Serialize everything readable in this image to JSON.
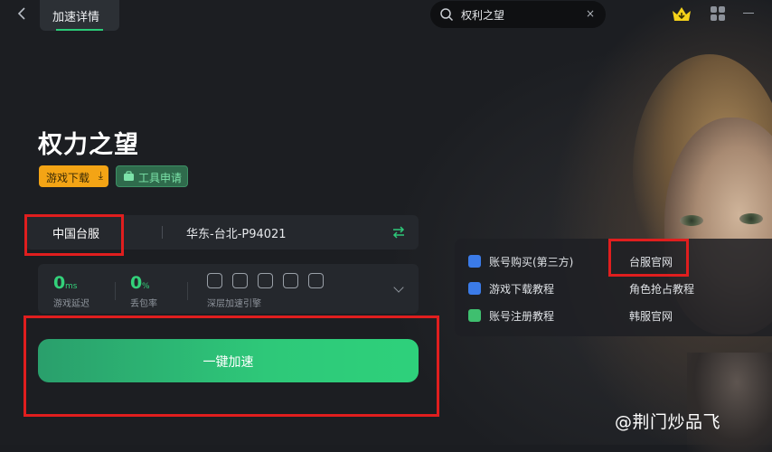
{
  "header": {
    "back_icon": "chevron-left-icon",
    "active_tab": "加速详情",
    "search_value": "权利之望",
    "search_clear": "×"
  },
  "game": {
    "title": "权力之望",
    "download_tag": "游戏下载",
    "download_tag_icon": "⤓",
    "tool_tag": "工具申请"
  },
  "server": {
    "region": "中国台服",
    "node": "华东-台北-P94021"
  },
  "stats": {
    "latency_value": "0",
    "latency_unit": "ms",
    "latency_label": "游戏延迟",
    "loss_value": "0",
    "loss_unit": "%",
    "loss_label": "丢包率",
    "engine_label": "深层加速引擎"
  },
  "accelerate_button": "一键加速",
  "links": {
    "left": [
      "账号购买(第三方)",
      "游戏下载教程",
      "账号注册教程"
    ],
    "right": [
      "台服官网",
      "角色抢占教程",
      "韩服官网"
    ]
  },
  "watermark": "@荆门炒品飞",
  "colors": {
    "accent_green": "#2ec879",
    "tag_orange": "#f3a415",
    "annotation_red": "#e01e1e"
  }
}
